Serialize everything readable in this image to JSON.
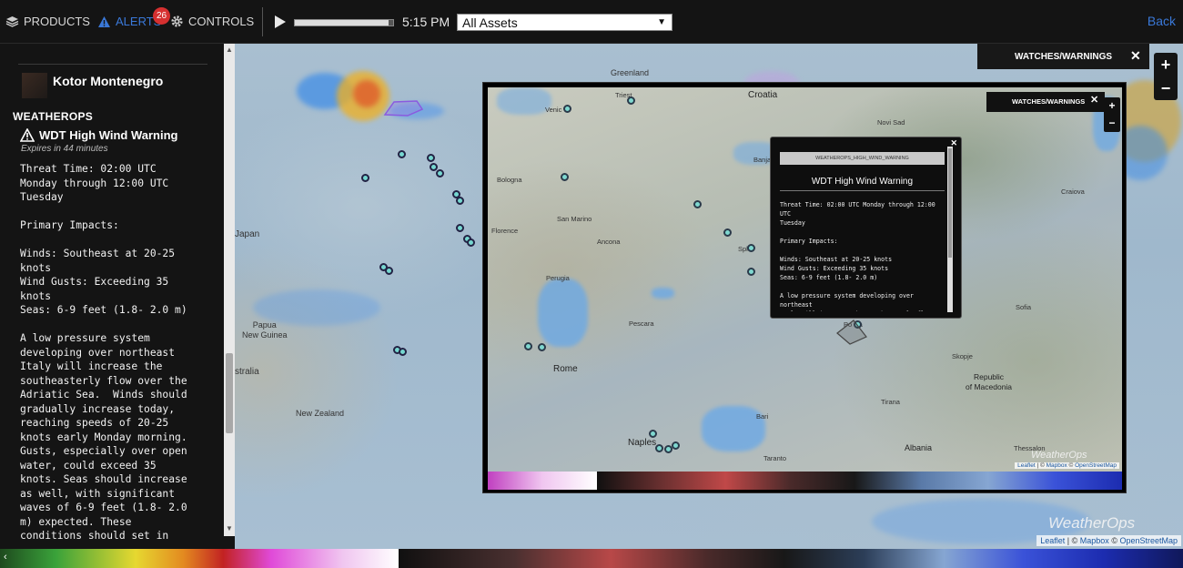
{
  "topbar": {
    "products_label": "PRODUCTS",
    "alerts_label": "ALERTS",
    "alerts_count": "26",
    "controls_label": "CONTROLS",
    "time": "5:15 PM",
    "timeline_progress": 0.95,
    "asset_select": "All Assets",
    "back_label": "Back"
  },
  "sidebar": {
    "location_name": "Kotor Montenegro",
    "section_title": "WEATHEROPS",
    "warning_title": "WDT High Wind Warning",
    "expires": "Expires in 44 minutes",
    "body": "Threat Time: 02:00 UTC\nMonday through 12:00 UTC\nTuesday\n\nPrimary Impacts:\n\nWinds: Southeast at 20-25\nknots\nWind Gusts: Exceeding 35\nknots\nSeas: 6-9 feet (1.8- 2.0 m)\n\nA low pressure system\ndeveloping over northeast\nItaly will increase the\nsoutheasterly flow over the\nAdriatic Sea.  Winds should\ngradually increase today,\nreaching speeds of 20-25\nknots early Monday morning.\nGusts, especially over open\nwater, could exceed 35\nknots. Seas should increase\nas well, with significant\nwaves of 6-9 feet (1.8- 2.0\nm) expected. These\nconditions should set in"
  },
  "map": {
    "watches_tab": "WATCHES/WARNINGS",
    "labels": {
      "greenland": "Greenland",
      "japan": "Japan",
      "papua": "Papua\nNew Guinea",
      "australia": "stralia",
      "new_zealand": "New Zealand"
    },
    "attribution": {
      "leaflet": "Leaflet",
      "sep": " | © ",
      "mapbox": "Mapbox",
      "osm": "OpenStreetMap"
    },
    "logo": "WeatherOps"
  },
  "inset": {
    "watches_tab": "WATCHES/WARNINGS",
    "labels": {
      "croatia": "Croatia",
      "trieste": "Triest",
      "venice": "Venic",
      "bologna": "Bologna",
      "florence": "Florence",
      "san_marino": "San Marino",
      "ancona": "Ancona",
      "perugia": "Perugia",
      "pescara": "Pescara",
      "rome": "Rome",
      "naples": "Naples",
      "bari": "Bari",
      "taranto": "Taranto",
      "novi_sad": "Novi Sad",
      "craiova": "Craiova",
      "sofia": "Sofia",
      "skopje": "Skopje",
      "macedonia": "Republic\nof Macedonia",
      "tirana": "Tirana",
      "albania": "Albania",
      "thessaloniki": "Thessalon",
      "banja": "Banja",
      "split": "Spl",
      "podgorica": "Po   ica"
    },
    "attribution": {
      "leaflet": "Leaflet",
      "sep": " | © ",
      "mapbox": "Mapbox",
      "osm": "OpenStreetMap"
    },
    "logo": "WeatherOps"
  },
  "popup": {
    "tag": "WEATHEROPS_HIGH_WIND_WARNING",
    "title": "WDT High Wind Warning",
    "body": "Threat Time: 02:00 UTC Monday through 12:00 UTC\nTuesday\n\nPrimary Impacts:\n\nWinds: Southeast at 20-25 knots\nWind Gusts: Exceeding 35 knots\nSeas: 6-9 feet (1.8- 2.0 m)\n\nA low pressure system developing over northeast\nItaly will increase the southeasterly flow over\nthe Adriatic Sea.  Winds should gradually increase\ntoday, reaching speeds of 20-25 knots early"
  },
  "colors": {
    "accent": "#3a78d8",
    "badge": "#d63030",
    "marker": "#76d7d0"
  }
}
